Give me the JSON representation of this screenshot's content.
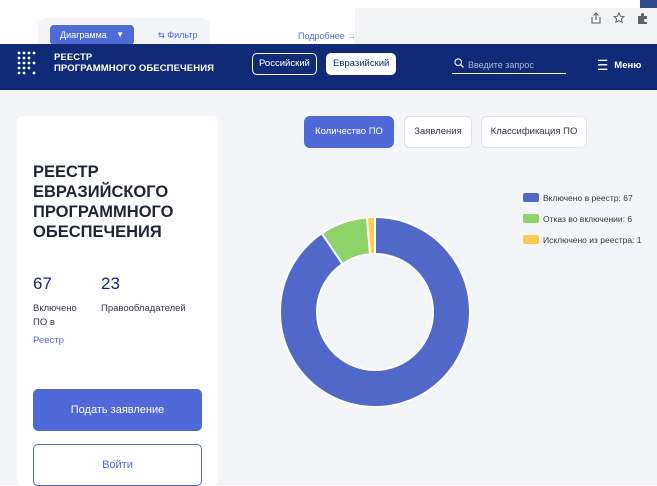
{
  "overlay": {
    "diagram_label": "Диаграмма",
    "caret": "▼",
    "filter_label": "⇆ Фильтр",
    "more_label": "Подробнее →"
  },
  "browser": {
    "icons": [
      "share-icon",
      "star-icon",
      "extension-icon"
    ]
  },
  "header": {
    "logo_line1": "РЕЕСТР",
    "logo_line2": "ПРОГРАММНОГО ОБЕСПЕЧЕНИЯ",
    "tabs": [
      {
        "label": "Российский",
        "active": false
      },
      {
        "label": "Евразийский",
        "active": true
      }
    ],
    "search_placeholder": "Введите запрос",
    "menu_label": "Меню"
  },
  "left_panel": {
    "title_lines": [
      "РЕЕСТР",
      "ЕВРАЗИЙСКОГО",
      "ПРОГРАММНОГО",
      "ОБЕСПЕЧЕНИЯ"
    ],
    "stats": [
      {
        "value": "67",
        "label_lines": [
          "Включено",
          "ПО в"
        ]
      },
      {
        "value": "23",
        "label_lines": [
          "Правообладателей"
        ]
      }
    ],
    "registry_link": "Реестр",
    "apply_button": "Подать заявление",
    "login_button": "Войти"
  },
  "chart_tabs": [
    {
      "label": "Количество ПО",
      "active": true
    },
    {
      "label": "Заявления",
      "active": false
    },
    {
      "label": "Классификация ПО",
      "active": false
    }
  ],
  "colors": {
    "header": "#0f2a77",
    "accent": "#5069d8",
    "included": "#5068c8",
    "rejected": "#8dd36a",
    "excluded": "#ffcb4f"
  },
  "chart_data": {
    "type": "pie",
    "donut": true,
    "labels": [
      "Включено в реестр: 67",
      "Отказ во включении: 6",
      "Исключено из реестра: 1"
    ],
    "values": [
      67,
      6,
      1
    ],
    "colors": [
      "#5068c8",
      "#8dd36a",
      "#ffcb4f"
    ],
    "legend_position": "right"
  }
}
